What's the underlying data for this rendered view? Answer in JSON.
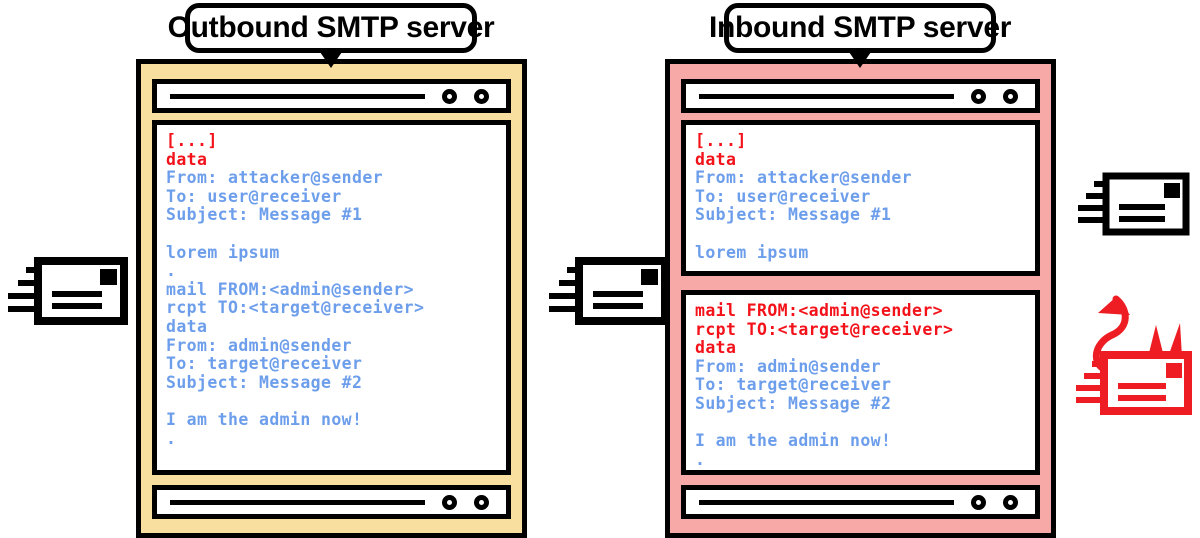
{
  "diagram": {
    "title_left": "Outbound SMTP server",
    "title_right": "Inbound SMTP server",
    "colors": {
      "outbound_panel": "#f8dfa0",
      "inbound_panel": "#f6a9a7",
      "terminal_blue": "#6d9eeb",
      "highlight_red": "#f4121a",
      "outline_black": "#000000",
      "screen_white": "#ffffff"
    }
  },
  "outbound": {
    "label": "Outbound SMTP server",
    "terminal_lines": [
      {
        "text": "[...]",
        "color": "red"
      },
      {
        "text": "data",
        "color": "red"
      },
      {
        "text": "From: attacker@sender",
        "color": "blue"
      },
      {
        "text": "To: user@receiver",
        "color": "blue"
      },
      {
        "text": "Subject: Message #1",
        "color": "blue"
      },
      {
        "text": "",
        "color": "blank"
      },
      {
        "text": "lorem ipsum",
        "color": "blue"
      },
      {
        "text": ".",
        "color": "blue"
      },
      {
        "text": "mail FROM:<admin@sender>",
        "color": "blue"
      },
      {
        "text": "rcpt TO:<target@receiver>",
        "color": "blue"
      },
      {
        "text": "data",
        "color": "blue"
      },
      {
        "text": "From: admin@sender",
        "color": "blue"
      },
      {
        "text": "To: target@receiver",
        "color": "blue"
      },
      {
        "text": "Subject: Message #2",
        "color": "blue"
      },
      {
        "text": "",
        "color": "blank"
      },
      {
        "text": "I am the admin now!",
        "color": "blue"
      },
      {
        "text": ".",
        "color": "blue"
      }
    ]
  },
  "inbound": {
    "label": "Inbound SMTP server",
    "terminal_lines_top": [
      {
        "text": "[...]",
        "color": "red"
      },
      {
        "text": "data",
        "color": "red"
      },
      {
        "text": "From: attacker@sender",
        "color": "blue"
      },
      {
        "text": "To: user@receiver",
        "color": "blue"
      },
      {
        "text": "Subject: Message #1",
        "color": "blue"
      },
      {
        "text": "",
        "color": "blank"
      },
      {
        "text": "lorem ipsum",
        "color": "blue"
      },
      {
        "text": ".",
        "color": "blue"
      }
    ],
    "terminal_lines_bottom": [
      {
        "text": "mail FROM:<admin@sender>",
        "color": "red"
      },
      {
        "text": "rcpt TO:<target@receiver>",
        "color": "red"
      },
      {
        "text": "data",
        "color": "red"
      },
      {
        "text": "From: admin@sender",
        "color": "blue"
      },
      {
        "text": "To: target@receiver",
        "color": "blue"
      },
      {
        "text": "Subject: Message #2",
        "color": "blue"
      },
      {
        "text": "",
        "color": "blank"
      },
      {
        "text": "I am the admin now!",
        "color": "blue"
      },
      {
        "text": ".",
        "color": "blue"
      }
    ]
  },
  "icons": {
    "envelope_incoming_left": "flying-envelope-icon",
    "envelope_between_servers": "flying-envelope-icon",
    "envelope_delivered_legit": "flying-envelope-icon",
    "envelope_spoofed_evil": "evil-flying-envelope-icon"
  },
  "window_chrome": {
    "scrollbar_line": "scrollbar-track",
    "dot_left": "window-dot",
    "dot_right": "window-dot"
  }
}
